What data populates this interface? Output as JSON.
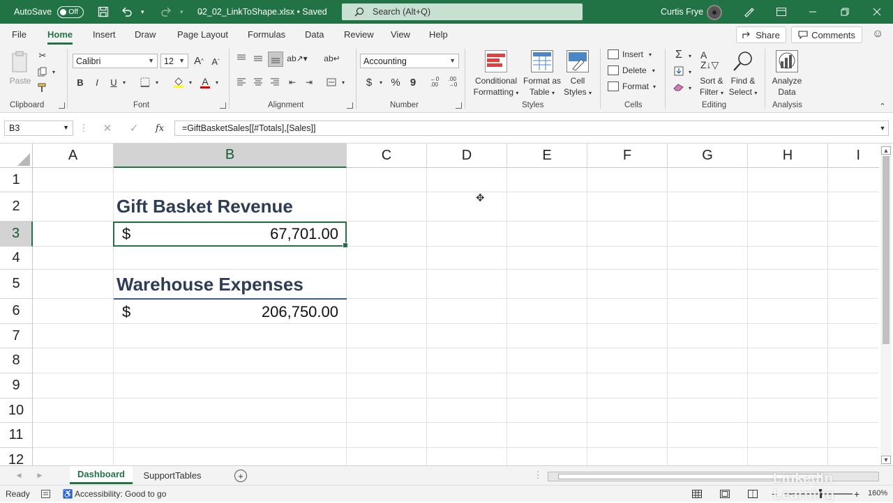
{
  "titlebar": {
    "autosave_label": "AutoSave",
    "autosave_state": "Off",
    "filename": "02_02_LinkToShape.xlsx • Saved",
    "search_placeholder": "Search (Alt+Q)",
    "user_name": "Curtis Frye"
  },
  "menu": {
    "tabs": [
      "File",
      "Home",
      "Insert",
      "Draw",
      "Page Layout",
      "Formulas",
      "Data",
      "Review",
      "View",
      "Help"
    ],
    "active": "Home",
    "share": "Share",
    "comments": "Comments"
  },
  "ribbon": {
    "clipboard": {
      "paste": "Paste",
      "label": "Clipboard"
    },
    "font": {
      "name": "Calibri",
      "size": "12",
      "label": "Font"
    },
    "alignment": {
      "label": "Alignment"
    },
    "number": {
      "format": "Accounting",
      "label": "Number"
    },
    "styles": {
      "conditional_line1": "Conditional",
      "conditional_line2": "Formatting",
      "format_table_line1": "Format as",
      "format_table_line2": "Table",
      "cell_styles_line1": "Cell",
      "cell_styles_line2": "Styles",
      "label": "Styles"
    },
    "cells": {
      "insert": "Insert",
      "delete": "Delete",
      "format": "Format",
      "label": "Cells"
    },
    "editing": {
      "sort_line1": "Sort &",
      "sort_line2": "Filter",
      "find_line1": "Find &",
      "find_line2": "Select",
      "label": "Editing"
    },
    "analysis": {
      "line1": "Analyze",
      "line2": "Data",
      "label": "Analysis"
    }
  },
  "formula_bar": {
    "name_box": "B3",
    "formula": "=GiftBasketSales[[#Totals],[Sales]]"
  },
  "grid": {
    "columns": [
      "A",
      "B",
      "C",
      "D",
      "E",
      "F",
      "G",
      "H",
      "I"
    ],
    "selected_column": "B",
    "rows": [
      "1",
      "2",
      "3",
      "4",
      "5",
      "6",
      "7",
      "8",
      "9",
      "10",
      "11",
      "12"
    ],
    "selected_row": "3",
    "cells": {
      "b2": "Gift Basket Revenue",
      "b3_currency": "$",
      "b3_value": "67,701.00",
      "b5": "Warehouse Expenses",
      "b6_currency": "$",
      "b6_value": "206,750.00"
    }
  },
  "sheets": {
    "tabs": [
      "Dashboard",
      "SupportTables"
    ],
    "active": "Dashboard"
  },
  "statusbar": {
    "ready": "Ready",
    "accessibility": "Accessibility: Good to go",
    "zoom": "160%"
  },
  "watermark": "LinkedIn Learning",
  "colors": {
    "excel_green": "#217346",
    "heading_text": "#2e3d56",
    "search_bg": "#c7e0d1"
  }
}
